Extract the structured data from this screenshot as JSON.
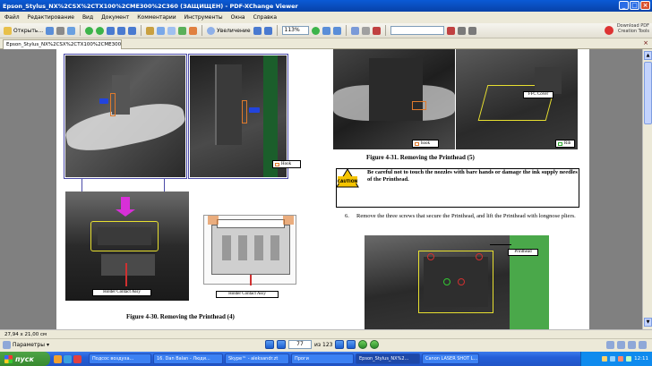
{
  "window": {
    "title": "Epson_Stylus_NX%2CSX%2CTX100%2CME300%2C360 (ЗАЩИЩЕН) - PDF-XChange Viewer"
  },
  "menu": [
    "Файл",
    "Редактирование",
    "Вид",
    "Документ",
    "Комментарии",
    "Инструменты",
    "Окна",
    "Справка"
  ],
  "toolbar": {
    "open_label": "Открыть...",
    "zoom_label": "Увеличение",
    "zoom_value": "113%"
  },
  "branding": {
    "line1": "Download PDF",
    "line2": "Creation Tools"
  },
  "tab": {
    "label": "Epson_Stylus_NX%2CSX%2CTX100%2CME300..."
  },
  "document": {
    "label_hook_a": "Hook",
    "label_holder_a": "Holder Contact Assy",
    "label_holder_b": "Holder Contact Assy",
    "caption_left": "Figure 4-30.  Removing the Printhead (4)",
    "label_hook_b": "hook",
    "label_ffc": "FFC Cover",
    "label_rib": "Rib",
    "caption_right": "Figure 4-31.  Removing the Printhead (5)",
    "caution_word": "CAUTION",
    "caution_text": "Be careful not to touch the nozzles with bare hands or damage the ink supply needles of the Printhead.",
    "step_number": "6.",
    "step_text": "Remove the three screws that secure the Printhead, and lift the Printhead with longnose pliers.",
    "label_printhead": "Printhead"
  },
  "status": {
    "page_size": "27,94 x 21,00 см"
  },
  "navigation": {
    "params_label": "Параметры",
    "current_page": "77",
    "page_of": "из 123"
  },
  "taskbar": {
    "start_label": "пуск",
    "items": [
      "Подсос воздуха...",
      "16. Dan Balan - Люди...",
      "Skype™ - aleksandr.zt",
      "Проги",
      "Epson_Stylus_NX%2...",
      "Canon LASER SHOT L..."
    ],
    "clock": "12:11"
  },
  "colors": {
    "accent": "#0a5ad6",
    "start": "#37892e",
    "orange_marker": "#e07a2c",
    "yellow_outline": "#e8e030",
    "green_label": "#32a832"
  }
}
